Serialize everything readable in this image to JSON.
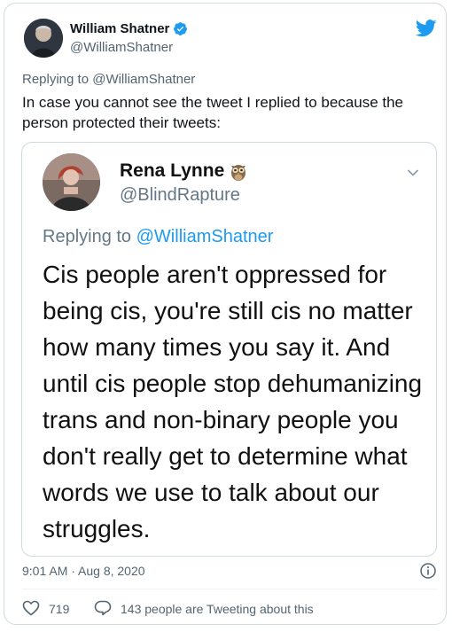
{
  "tweet": {
    "author_name": "William Shatner",
    "author_handle": "@WilliamShatner",
    "replying_to": "Replying to @WilliamShatner",
    "text": "In case you cannot see the tweet I replied to because the person protected their tweets:",
    "timestamp": "9:01 AM · Aug 8, 2020",
    "like_count": "719",
    "quote_text": "143 people are Tweeting about this"
  },
  "embedded": {
    "author_name": "Rena Lynne",
    "author_handle": "@BlindRapture",
    "replying_prefix": "Replying to ",
    "replying_mention": "@WilliamShatner",
    "text": "Cis people aren't oppressed for being cis, you're still cis no matter how many times you say it. And until cis people stop dehumanizing trans and non-binary people  you don't really get to determine what words we use to talk about our struggles."
  },
  "icons": {
    "verified": "verified-badge-icon",
    "logo": "twitter-bird-icon",
    "owl": "owl-emoji-icon",
    "caret": "chevron-down-icon",
    "info": "info-icon",
    "like": "heart-icon",
    "reply": "speech-bubble-icon"
  },
  "colors": {
    "accent": "#1d9bf0",
    "text": "#0f1419",
    "secondary": "#536471",
    "border": "#cfd9de"
  }
}
